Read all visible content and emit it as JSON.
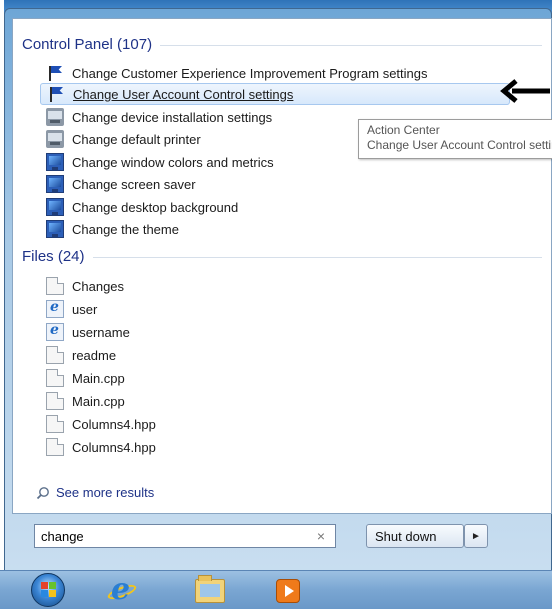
{
  "control_panel": {
    "header": "Control Panel (107)",
    "items": [
      {
        "label": "Change Customer Experience Improvement Program settings",
        "icon": "flag-icon"
      },
      {
        "label": "Change User Account Control settings",
        "icon": "flag-icon",
        "selected": true
      },
      {
        "label": "Change device installation settings",
        "icon": "device-icon"
      },
      {
        "label": "Change default printer",
        "icon": "device-icon"
      },
      {
        "label": "Change window colors and metrics",
        "icon": "monitor-icon"
      },
      {
        "label": "Change screen saver",
        "icon": "monitor-icon"
      },
      {
        "label": "Change desktop background",
        "icon": "monitor-icon"
      },
      {
        "label": "Change the theme",
        "icon": "monitor-icon"
      }
    ]
  },
  "tooltip": {
    "line1": "Action Center",
    "line2": "Change User Account Control settings"
  },
  "files": {
    "header": "Files (24)",
    "items": [
      {
        "label": "Changes",
        "icon": "document-icon"
      },
      {
        "label": "user",
        "icon": "ie-file-icon"
      },
      {
        "label": "username",
        "icon": "ie-file-icon"
      },
      {
        "label": "readme",
        "icon": "document-icon"
      },
      {
        "label": "Main.cpp",
        "icon": "document-icon"
      },
      {
        "label": "Main.cpp",
        "icon": "document-icon"
      },
      {
        "label": "Columns4.hpp",
        "icon": "document-icon"
      },
      {
        "label": "Columns4.hpp",
        "icon": "document-icon"
      }
    ]
  },
  "see_more": {
    "label": "See more results",
    "icon": "magnifier-icon"
  },
  "search": {
    "value": "change",
    "clear_glyph": "×"
  },
  "shutdown": {
    "label": "Shut down",
    "arrow_glyph": "►"
  },
  "taskbar": {
    "items": [
      "start-orb-icon",
      "internet-explorer-icon",
      "windows-explorer-icon",
      "media-player-icon"
    ]
  },
  "colors": {
    "group_header": "#1e3287",
    "selection": "#d7e8fb",
    "taskbar": "#7aa6d2"
  }
}
